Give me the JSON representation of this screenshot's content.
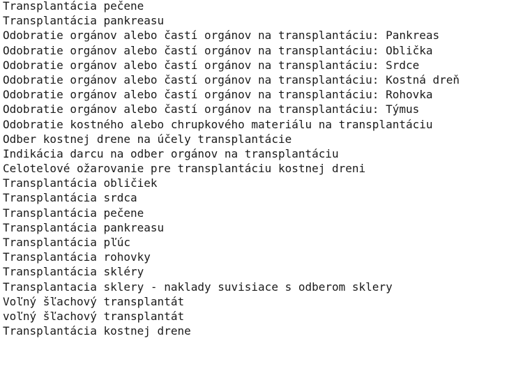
{
  "lines": [
    "Transplantácia pečene",
    "Transplantácia pankreasu",
    "Odobratie orgánov alebo častí orgánov na transplantáciu: Pankreas",
    "Odobratie orgánov alebo častí orgánov na transplantáciu: Oblička",
    "Odobratie orgánov alebo častí orgánov na transplantáciu: Srdce",
    "Odobratie orgánov alebo častí orgánov na transplantáciu: Kostná dreň",
    "Odobratie orgánov alebo častí orgánov na transplantáciu: Rohovka",
    "Odobratie orgánov alebo častí orgánov na transplantáciu: Týmus",
    "Odobratie kostného alebo chrupkového materiálu na transplantáciu",
    "Odber kostnej drene na účely transplantácie",
    "Indikácia darcu na odber orgánov na transplantáciu",
    "Celotelové ožarovanie pre transplantáciu kostnej dreni",
    "Transplantácia obličiek",
    "Transplantácia srdca",
    "Transplantácia pečene",
    "Transplantácia pankreasu",
    "Transplantácia pľúc",
    "Transplantácia rohovky",
    "Transplantácia skléry",
    "Transplantacia sklery - naklady suvisiace s odberom sklery",
    "Voľný šľachový transplantát",
    "voľný šľachový transplantát",
    "Transplantácia kostnej drene"
  ]
}
